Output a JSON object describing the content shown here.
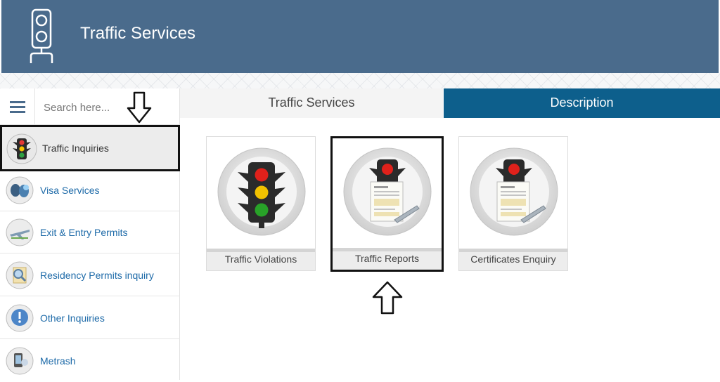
{
  "header": {
    "title": "Traffic Services",
    "logo_icon": "traffic-light-icon",
    "bg_color": "#4a6b8c"
  },
  "search": {
    "placeholder": "Search here...",
    "value": ""
  },
  "sidebar": {
    "items": [
      {
        "label": "Traffic Inquiries",
        "icon": "traffic-light-icon",
        "active": true
      },
      {
        "label": "Visa Services",
        "icon": "visa-icon",
        "active": false
      },
      {
        "label": "Exit & Entry Permits",
        "icon": "airplane-icon",
        "active": false
      },
      {
        "label": "Residency Permits inquiry",
        "icon": "residency-search-icon",
        "active": false
      },
      {
        "label": "Other Inquiries",
        "icon": "exclamation-icon",
        "active": false
      },
      {
        "label": "Metrash",
        "icon": "metrash-icon",
        "active": false
      }
    ]
  },
  "tabs": [
    {
      "label": "Traffic Services",
      "active": false
    },
    {
      "label": "Description",
      "active": true
    }
  ],
  "cards": [
    {
      "label": "Traffic Violations",
      "icon": "traffic-light-icon"
    },
    {
      "label": "Traffic Reports",
      "icon": "traffic-report-icon",
      "highlighted": true
    },
    {
      "label": "Certificates Enquiry",
      "icon": "certificate-icon"
    }
  ],
  "colors": {
    "accent": "#0d5f8c",
    "link": "#1d6aa8",
    "header": "#4a6b8c"
  }
}
